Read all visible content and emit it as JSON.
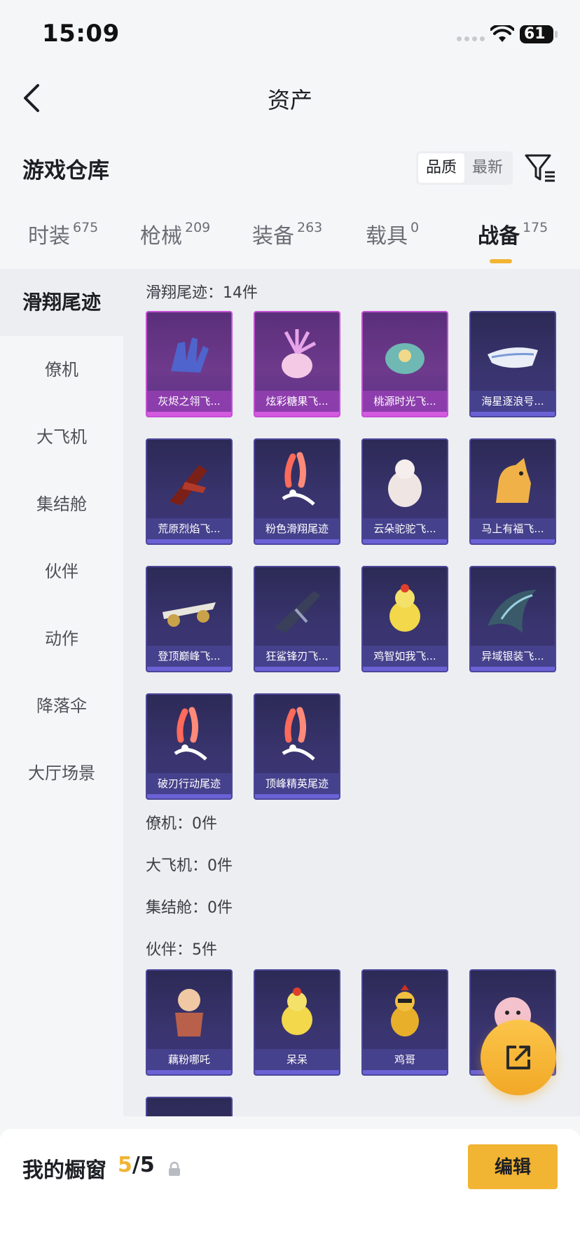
{
  "status": {
    "time": "15:09",
    "battery": "61"
  },
  "nav": {
    "title": "资产"
  },
  "warehouse": {
    "title": "游戏仓库",
    "sort_quality": "品质",
    "sort_newest": "最新"
  },
  "tabs": [
    {
      "label": "时装",
      "count": "675"
    },
    {
      "label": "枪械",
      "count": "209"
    },
    {
      "label": "装备",
      "count": "263"
    },
    {
      "label": "载具",
      "count": "0"
    },
    {
      "label": "战备",
      "count": "175"
    }
  ],
  "sidebar": [
    {
      "label": "滑翔尾迹"
    },
    {
      "label": "僚机"
    },
    {
      "label": "大飞机"
    },
    {
      "label": "集结舱"
    },
    {
      "label": "伙伴"
    },
    {
      "label": "动作"
    },
    {
      "label": "降落伞"
    },
    {
      "label": "大厅场景"
    }
  ],
  "sections": {
    "glide_trail": {
      "title": "滑翔尾迹：14件"
    },
    "wingman": {
      "title": "僚机：0件"
    },
    "big_plane": {
      "title": "大飞机：0件"
    },
    "assembly_pod": {
      "title": "集结舱：0件"
    },
    "partner": {
      "title": "伙伴：5件"
    }
  },
  "glide_items": [
    {
      "name": "灰烬之翎飞...",
      "icon": "glove-icon",
      "rarity": "purple"
    },
    {
      "name": "炫彩糖果飞...",
      "icon": "candy-icon",
      "rarity": "purple"
    },
    {
      "name": "桃源时光飞...",
      "icon": "lantern-icon",
      "rarity": "purple"
    },
    {
      "name": "海星逐浪号...",
      "icon": "boat-icon",
      "rarity": "blue"
    },
    {
      "name": "荒原烈焰飞...",
      "icon": "jet-icon",
      "rarity": "blue"
    },
    {
      "name": "粉色滑翔尾迹",
      "icon": "trail-icon",
      "rarity": "blue"
    },
    {
      "name": "云朵驼驼飞...",
      "icon": "alpaca-icon",
      "rarity": "blue"
    },
    {
      "name": "马上有福飞...",
      "icon": "horse-icon",
      "rarity": "blue"
    },
    {
      "name": "登顶巅峰飞...",
      "icon": "plane-icon",
      "rarity": "blue"
    },
    {
      "name": "狂鲨锋刃飞...",
      "icon": "shark-icon",
      "rarity": "blue"
    },
    {
      "name": "鸡智如我飞...",
      "icon": "chick-icon",
      "rarity": "blue"
    },
    {
      "name": "异域银装飞...",
      "icon": "wing-icon",
      "rarity": "blue"
    },
    {
      "name": "破刃行动尾迹",
      "icon": "trail-icon",
      "rarity": "blue"
    },
    {
      "name": "顶峰精英尾迹",
      "icon": "trail-icon",
      "rarity": "blue"
    }
  ],
  "partner_items": [
    {
      "name": "藕粉哪吒",
      "icon": "nezha-icon",
      "rarity": "blue"
    },
    {
      "name": "呆呆",
      "icon": "chick-icon",
      "rarity": "blue"
    },
    {
      "name": "鸡哥",
      "icon": "rooster-icon",
      "rarity": "blue"
    },
    {
      "name": "",
      "icon": "pig-icon",
      "rarity": "blue"
    }
  ],
  "showcase": {
    "label": "我的橱窗",
    "current": "5",
    "total": "/5",
    "edit": "编辑"
  },
  "colors": {
    "accent": "#f2b433",
    "purple_border": "#c64fd6",
    "blue_border": "#4c4699"
  }
}
